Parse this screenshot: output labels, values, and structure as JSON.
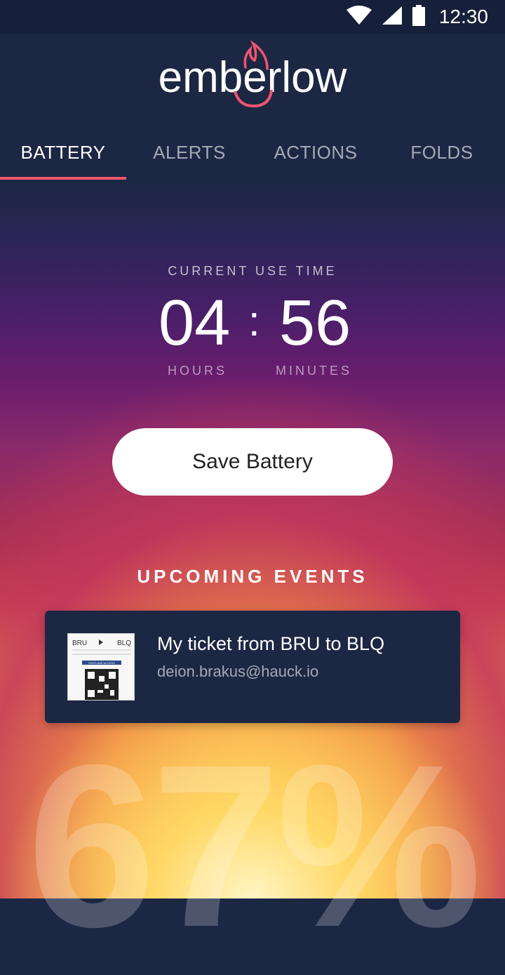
{
  "status_bar": {
    "time": "12:30",
    "wifi_icon": "wifi-icon",
    "signal_icon": "signal-icon",
    "battery_icon": "battery-icon"
  },
  "app": {
    "logo_text": "emberlow",
    "accent_color": "#f0556e"
  },
  "tabs": [
    {
      "label": "BATTERY",
      "active": true
    },
    {
      "label": "ALERTS",
      "active": false
    },
    {
      "label": "ACTIONS",
      "active": false
    },
    {
      "label": "FOLDS",
      "active": false
    }
  ],
  "usage": {
    "label": "CURRENT USE TIME",
    "hours": "04",
    "separator": ":",
    "minutes": "56",
    "hours_unit": "HOURS",
    "minutes_unit": "MINUTES"
  },
  "save_button": {
    "label": "Save Battery"
  },
  "events": {
    "title": "UPCOMING EVENTS",
    "items": [
      {
        "title": "My ticket from BRU to BLQ",
        "subtitle": "deion.brakus@hauck.io",
        "thumbnail_icon": "boarding-pass-icon",
        "ticket": {
          "from": "BRU",
          "to": "BLQ",
          "banner": "FASTLANE ACCESS"
        }
      }
    ]
  },
  "battery": {
    "percent_text": "67%"
  }
}
